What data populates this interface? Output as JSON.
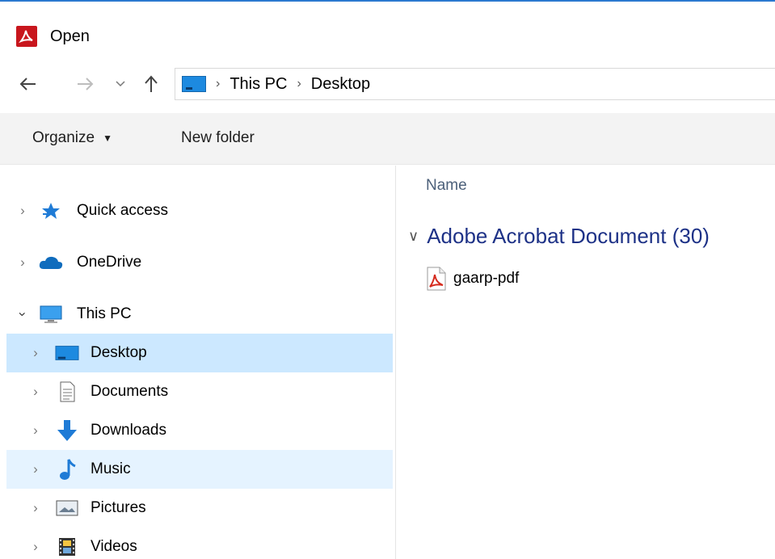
{
  "window": {
    "title": "Open",
    "accent_color": "#2b79d0",
    "app_icon": "adobe-acrobat-icon"
  },
  "navigation": {
    "back_icon": "arrow-left-icon",
    "forward_icon": "arrow-right-icon",
    "recent_icon": "chevron-down-icon",
    "up_icon": "arrow-up-icon",
    "breadcrumbs": [
      "This PC",
      "Desktop"
    ]
  },
  "toolbar": {
    "organize_label": "Organize",
    "new_folder_label": "New folder"
  },
  "sidebar": {
    "items": [
      {
        "label": "Quick access",
        "icon": "star-icon",
        "expanded": false
      },
      {
        "label": "OneDrive",
        "icon": "cloud-icon",
        "expanded": false
      },
      {
        "label": "This PC",
        "icon": "computer-icon",
        "expanded": true
      },
      {
        "label": "Desktop",
        "icon": "desktop-icon",
        "selected": true
      },
      {
        "label": "Documents",
        "icon": "document-icon"
      },
      {
        "label": "Downloads",
        "icon": "download-arrow-icon"
      },
      {
        "label": "Music",
        "icon": "music-note-icon",
        "hovered": true
      },
      {
        "label": "Pictures",
        "icon": "picture-icon"
      },
      {
        "label": "Videos",
        "icon": "film-icon"
      }
    ],
    "selected_color": "#cce8ff",
    "hover_color": "#e5f3ff"
  },
  "content": {
    "column_header": "Name",
    "group": {
      "label": "Adobe Acrobat Document (30)",
      "color": "#1e3287"
    },
    "files": [
      {
        "name": "gaarp-pdf",
        "icon": "pdf-file-icon"
      }
    ]
  }
}
